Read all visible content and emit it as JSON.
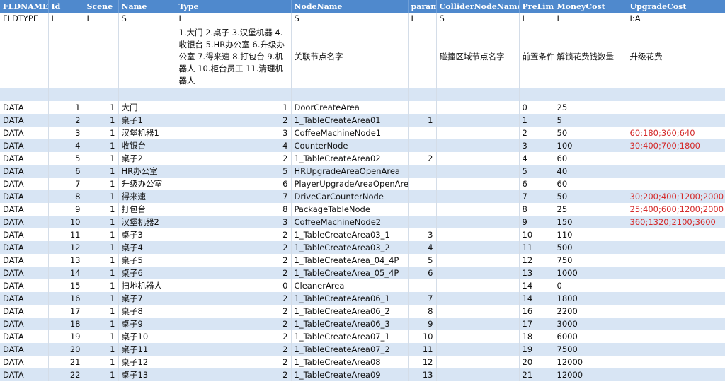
{
  "columns": [
    {
      "key": "fldname",
      "header": "FLDNAME",
      "type": "FLDTYPE",
      "desc": ""
    },
    {
      "key": "id",
      "header": "Id",
      "type": "I",
      "desc": ""
    },
    {
      "key": "scene",
      "header": "Scene",
      "type": "I",
      "desc": ""
    },
    {
      "key": "name",
      "header": "Name",
      "type": "S",
      "desc": ""
    },
    {
      "key": "type",
      "header": "Type",
      "type": "I",
      "desc": "1.大门 2.桌子 3.汉堡机器 4.收银台 5.HR办公室 6.升级办公室 7.得来速 8.打包台 9.机器人 10.柜台员工 11.清理机器人"
    },
    {
      "key": "nodeName",
      "header": "NodeName",
      "type": "S",
      "desc": "关联节点名字"
    },
    {
      "key": "param",
      "header": "param",
      "type": "I",
      "desc": ""
    },
    {
      "key": "collider",
      "header": "ColliderNodeName",
      "type": "S",
      "desc": "碰撞区域节点名字"
    },
    {
      "key": "preLimit",
      "header": "PreLimit",
      "type": "I",
      "desc": "前置条件"
    },
    {
      "key": "moneyCost",
      "header": "MoneyCost",
      "type": "I",
      "desc": "解锁花费钱数量"
    },
    {
      "key": "upgradeCost",
      "header": "UpgradeCost",
      "type": "I:A",
      "desc": "升级花费"
    }
  ],
  "rows": [
    {
      "fldname": "DATA",
      "id": "1",
      "scene": "1",
      "name": "大门",
      "type": "1",
      "nodeName": "DoorCreateArea",
      "param": "",
      "collider": "",
      "preLimit": "0",
      "moneyCost": "25",
      "upgradeCost": ""
    },
    {
      "fldname": "DATA",
      "id": "2",
      "scene": "1",
      "name": "桌子1",
      "type": "2",
      "nodeName": "1_TableCreateArea01",
      "param": "1",
      "collider": "",
      "preLimit": "1",
      "moneyCost": "5",
      "upgradeCost": ""
    },
    {
      "fldname": "DATA",
      "id": "3",
      "scene": "1",
      "name": "汉堡机器1",
      "type": "3",
      "nodeName": "CoffeeMachineNode1",
      "param": "",
      "collider": "",
      "preLimit": "2",
      "moneyCost": "50",
      "upgradeCost": "60;180;360;640"
    },
    {
      "fldname": "DATA",
      "id": "4",
      "scene": "1",
      "name": "收银台",
      "type": "4",
      "nodeName": "CounterNode",
      "param": "",
      "collider": "",
      "preLimit": "3",
      "moneyCost": "100",
      "upgradeCost": "30;400;700;1800"
    },
    {
      "fldname": "DATA",
      "id": "5",
      "scene": "1",
      "name": "桌子2",
      "type": "2",
      "nodeName": "1_TableCreateArea02",
      "param": "2",
      "collider": "",
      "preLimit": "4",
      "moneyCost": "60",
      "upgradeCost": ""
    },
    {
      "fldname": "DATA",
      "id": "6",
      "scene": "1",
      "name": "HR办公室",
      "type": "5",
      "nodeName": "HRUpgradeAreaOpenArea",
      "param": "",
      "collider": "",
      "preLimit": "5",
      "moneyCost": "40",
      "upgradeCost": ""
    },
    {
      "fldname": "DATA",
      "id": "7",
      "scene": "1",
      "name": "升级办公室",
      "type": "6",
      "nodeName": "PlayerUpgradeAreaOpenArea",
      "param": "",
      "collider": "",
      "preLimit": "6",
      "moneyCost": "60",
      "upgradeCost": ""
    },
    {
      "fldname": "DATA",
      "id": "8",
      "scene": "1",
      "name": "得来速",
      "type": "7",
      "nodeName": "DriveCarCounterNode",
      "param": "",
      "collider": "",
      "preLimit": "7",
      "moneyCost": "50",
      "upgradeCost": "30;200;400;1200;2000"
    },
    {
      "fldname": "DATA",
      "id": "9",
      "scene": "1",
      "name": "打包台",
      "type": "8",
      "nodeName": "PackageTableNode",
      "param": "",
      "collider": "",
      "preLimit": "8",
      "moneyCost": "25",
      "upgradeCost": "25;400;600;1200;2000"
    },
    {
      "fldname": "DATA",
      "id": "10",
      "scene": "1",
      "name": "汉堡机器2",
      "type": "3",
      "nodeName": "CoffeeMachineNode2",
      "param": "",
      "collider": "",
      "preLimit": "9",
      "moneyCost": "150",
      "upgradeCost": "360;1320;2100;3600"
    },
    {
      "fldname": "DATA",
      "id": "11",
      "scene": "1",
      "name": "桌子3",
      "type": "2",
      "nodeName": "1_TableCreateArea03_1",
      "param": "3",
      "collider": "",
      "preLimit": "10",
      "moneyCost": "110",
      "upgradeCost": ""
    },
    {
      "fldname": "DATA",
      "id": "12",
      "scene": "1",
      "name": "桌子4",
      "type": "2",
      "nodeName": "1_TableCreateArea03_2",
      "param": "4",
      "collider": "",
      "preLimit": "11",
      "moneyCost": "500",
      "upgradeCost": ""
    },
    {
      "fldname": "DATA",
      "id": "13",
      "scene": "1",
      "name": "桌子5",
      "type": "2",
      "nodeName": "1_TableCreateArea_04_4P",
      "param": "5",
      "collider": "",
      "preLimit": "12",
      "moneyCost": "750",
      "upgradeCost": ""
    },
    {
      "fldname": "DATA",
      "id": "14",
      "scene": "1",
      "name": "桌子6",
      "type": "2",
      "nodeName": "1_TableCreateArea_05_4P",
      "param": "6",
      "collider": "",
      "preLimit": "13",
      "moneyCost": "1000",
      "upgradeCost": ""
    },
    {
      "fldname": "DATA",
      "id": "15",
      "scene": "1",
      "name": "扫地机器人",
      "type": "0",
      "nodeName": "CleanerArea",
      "param": "",
      "collider": "",
      "preLimit": "14",
      "moneyCost": "0",
      "upgradeCost": ""
    },
    {
      "fldname": "DATA",
      "id": "16",
      "scene": "1",
      "name": "桌子7",
      "type": "2",
      "nodeName": "1_TableCreateArea06_1",
      "param": "7",
      "collider": "",
      "preLimit": "14",
      "moneyCost": "1800",
      "upgradeCost": ""
    },
    {
      "fldname": "DATA",
      "id": "17",
      "scene": "1",
      "name": "桌子8",
      "type": "2",
      "nodeName": "1_TableCreateArea06_2",
      "param": "8",
      "collider": "",
      "preLimit": "16",
      "moneyCost": "2200",
      "upgradeCost": ""
    },
    {
      "fldname": "DATA",
      "id": "18",
      "scene": "1",
      "name": "桌子9",
      "type": "2",
      "nodeName": "1_TableCreateArea06_3",
      "param": "9",
      "collider": "",
      "preLimit": "17",
      "moneyCost": "3000",
      "upgradeCost": ""
    },
    {
      "fldname": "DATA",
      "id": "19",
      "scene": "1",
      "name": "桌子10",
      "type": "2",
      "nodeName": "1_TableCreateArea07_1",
      "param": "10",
      "collider": "",
      "preLimit": "18",
      "moneyCost": "6000",
      "upgradeCost": ""
    },
    {
      "fldname": "DATA",
      "id": "20",
      "scene": "1",
      "name": "桌子11",
      "type": "2",
      "nodeName": "1_TableCreateArea07_2",
      "param": "11",
      "collider": "",
      "preLimit": "19",
      "moneyCost": "7500",
      "upgradeCost": ""
    },
    {
      "fldname": "DATA",
      "id": "21",
      "scene": "1",
      "name": "桌子12",
      "type": "2",
      "nodeName": "1_TableCreateArea08",
      "param": "12",
      "collider": "",
      "preLimit": "20",
      "moneyCost": "12000",
      "upgradeCost": ""
    },
    {
      "fldname": "DATA",
      "id": "22",
      "scene": "1",
      "name": "桌子13",
      "type": "2",
      "nodeName": "1_TableCreateArea09",
      "param": "13",
      "collider": "",
      "preLimit": "21",
      "moneyCost": "12000",
      "upgradeCost": ""
    }
  ],
  "colors": {
    "header_bg": "#4f89cd",
    "header_text": "#ffffff",
    "band_bg": "#d8e5f4",
    "upgrade_cost_text": "#d42b2b"
  }
}
